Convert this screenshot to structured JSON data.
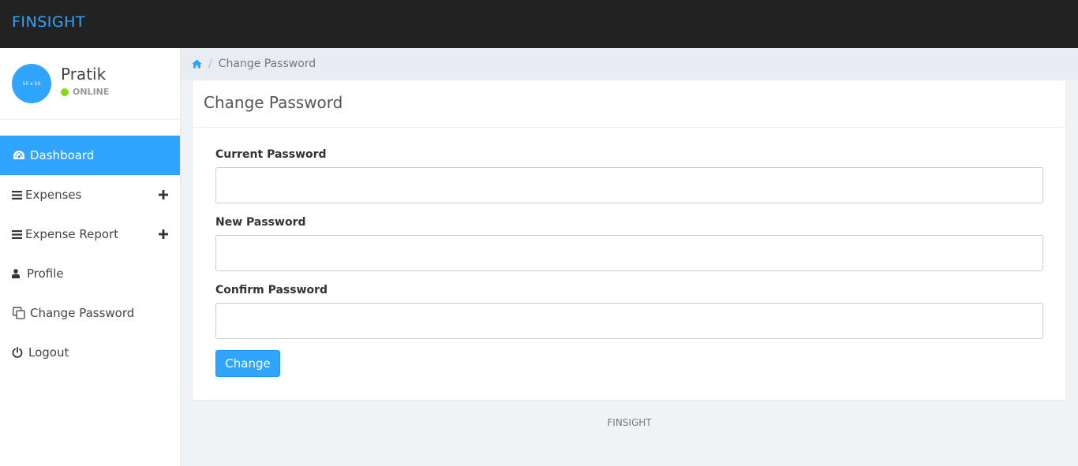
{
  "app": {
    "brand": "FINSIGHT",
    "accent_color": "#30a5ff",
    "topbar_color": "#222222"
  },
  "sidebar": {
    "profile": {
      "avatar_text": "50 x 50",
      "name": "Pratik",
      "status": "ONLINE",
      "status_color": "#8ad919"
    },
    "items": [
      {
        "label": "Dashboard",
        "icon": "dashboard-icon",
        "active": true
      },
      {
        "label": "Expenses",
        "icon": "bars-icon",
        "expandable": true
      },
      {
        "label": "Expense Report",
        "icon": "bars-icon",
        "expandable": true
      },
      {
        "label": "Profile",
        "icon": "user-icon"
      },
      {
        "label": "Change Password",
        "icon": "clone-icon"
      },
      {
        "label": "Logout",
        "icon": "power-icon"
      }
    ]
  },
  "breadcrumb": {
    "home_icon": "home-icon",
    "current": "Change Password"
  },
  "panel": {
    "title": "Change Password",
    "fields": [
      {
        "label": "Current Password",
        "value": "",
        "placeholder": ""
      },
      {
        "label": "New Password",
        "value": "",
        "placeholder": ""
      },
      {
        "label": "Confirm Password",
        "value": "",
        "placeholder": ""
      }
    ],
    "submit_label": "Change"
  },
  "footer": {
    "text": "FINSIGHT"
  }
}
